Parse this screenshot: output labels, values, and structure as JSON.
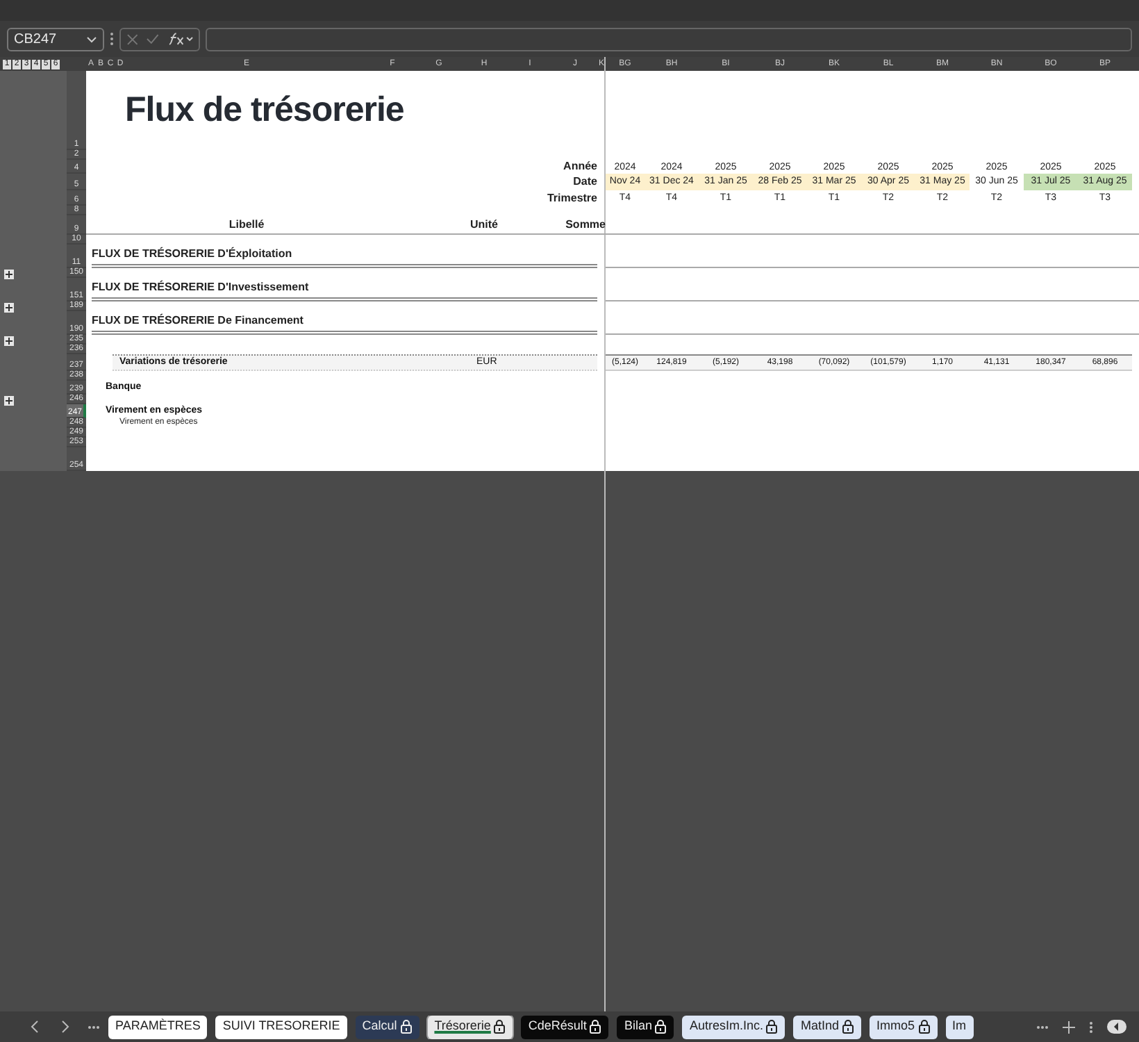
{
  "formula_bar": {
    "name_box": "CB247"
  },
  "outline_levels": [
    "1",
    "2",
    "3",
    "4",
    "5",
    "6"
  ],
  "columns_left": [
    "A",
    "B",
    "C",
    "D",
    "E",
    "F",
    "G",
    "H",
    "I",
    "J",
    "K"
  ],
  "columns_right": [
    "BG",
    "BH",
    "BI",
    "BJ",
    "BK",
    "BL",
    "BM",
    "BN",
    "BO",
    "BP"
  ],
  "periods": [
    {
      "year": "2024",
      "date": "Nov 24",
      "quarter": "T4",
      "color": "#fdf0cc",
      "variation": "(5,124)"
    },
    {
      "year": "2024",
      "date": "31 Dec 24",
      "quarter": "T4",
      "color": "#fdf0cc",
      "variation": "124,819"
    },
    {
      "year": "2025",
      "date": "31 Jan 25",
      "quarter": "T1",
      "color": "#fdf0cc",
      "variation": "(5,192)"
    },
    {
      "year": "2025",
      "date": "28 Feb 25",
      "quarter": "T1",
      "color": "#fdf0cc",
      "variation": "43,198"
    },
    {
      "year": "2025",
      "date": "31 Mar 25",
      "quarter": "T1",
      "color": "#fdf0cc",
      "variation": "(70,092)"
    },
    {
      "year": "2025",
      "date": "30 Apr 25",
      "quarter": "T2",
      "color": "#fdf0cc",
      "variation": "(101,579)"
    },
    {
      "year": "2025",
      "date": "31 May 25",
      "quarter": "T2",
      "color": "#fdf0cc",
      "variation": "1,170"
    },
    {
      "year": "2025",
      "date": "30 Jun 25",
      "quarter": "T2",
      "color": "#ffffff",
      "variation": "41,131"
    },
    {
      "year": "2025",
      "date": "31 Jul 25",
      "quarter": "T3",
      "color": "#c6e0b4",
      "variation": "180,347"
    },
    {
      "year": "2025",
      "date": "31 Aug 25",
      "quarter": "T3",
      "color": "#c6e0b4",
      "variation": "68,896"
    }
  ],
  "rows": [
    {
      "number": "1",
      "kind": "title",
      "selected": false,
      "label": "Flux de trésorerie"
    },
    {
      "number": "2",
      "kind": "spacer",
      "selected": false
    },
    {
      "number": "4",
      "kind": "year",
      "selected": false,
      "label": "Année"
    },
    {
      "number": "5",
      "kind": "date",
      "selected": false,
      "label": "Date"
    },
    {
      "number": "6",
      "kind": "quarter",
      "selected": false,
      "label": "Trimestre"
    },
    {
      "number": "8",
      "kind": "spacer",
      "selected": false
    },
    {
      "number": "9",
      "kind": "header",
      "selected": false,
      "label": "Libellé",
      "unit": "Unité",
      "sum": "Somme"
    },
    {
      "number": "10",
      "kind": "spacer",
      "selected": false
    },
    {
      "number": "11",
      "kind": "section",
      "selected": false,
      "label": "FLUX DE TRÉSORERIE D'Éxploitation"
    },
    {
      "number": "150",
      "kind": "spacer",
      "selected": false,
      "expanded": false
    },
    {
      "number": "151",
      "kind": "section",
      "selected": false,
      "label": "FLUX DE TRÉSORERIE D'Investissement"
    },
    {
      "number": "189",
      "kind": "spacer",
      "selected": false,
      "expanded": false
    },
    {
      "number": "190",
      "kind": "section",
      "selected": false,
      "label": "FLUX DE TRÉSORERIE De Financement"
    },
    {
      "number": "235",
      "kind": "spacer",
      "selected": false,
      "expanded": false
    },
    {
      "number": "236",
      "kind": "spacer",
      "selected": false
    },
    {
      "number": "237",
      "kind": "total",
      "selected": false,
      "label": "Variations de trésorerie",
      "unit": "EUR"
    },
    {
      "number": "238",
      "kind": "spacer",
      "selected": false
    },
    {
      "number": "239",
      "kind": "group",
      "selected": false,
      "label": "Banque"
    },
    {
      "number": "246",
      "kind": "spacer",
      "selected": false,
      "expanded": false
    },
    {
      "number": "247",
      "kind": "group",
      "selected": true,
      "label": "Virement en espèces"
    },
    {
      "number": "248",
      "kind": "item",
      "selected": false,
      "label": "Virement en espèces"
    },
    {
      "number": "249",
      "kind": "spacer",
      "selected": false
    },
    {
      "number": "253",
      "kind": "spacer",
      "selected": false
    },
    {
      "number": "254",
      "kind": "end",
      "selected": false
    }
  ],
  "sheet_tabs": [
    {
      "label": "PARAMÈTRES",
      "color": "#ffffff",
      "locked": false,
      "selected": false
    },
    {
      "label": "SUIVI TRESORERIE",
      "color": "#ffffff",
      "locked": false,
      "selected": false
    },
    {
      "label": "Calcul",
      "color": "#2c3a55",
      "locked": true,
      "selected": false
    },
    {
      "label": "Trésorerie",
      "color": "#e8e8e8",
      "locked": true,
      "selected": true
    },
    {
      "label": "CdeRésult",
      "color": "#0a0a0a",
      "locked": true,
      "selected": false
    },
    {
      "label": "Bilan",
      "color": "#0a0a0a",
      "locked": true,
      "selected": false
    },
    {
      "label": "AutresIm.Inc.",
      "color": "#dde6f5",
      "locked": true,
      "selected": false
    },
    {
      "label": "MatInd",
      "color": "#dde6f5",
      "locked": true,
      "selected": false
    },
    {
      "label": "Immo5",
      "color": "#dde6f5",
      "locked": true,
      "selected": false
    },
    {
      "label": "Im",
      "color": "#dde6f5",
      "locked": false,
      "selected": false
    }
  ]
}
